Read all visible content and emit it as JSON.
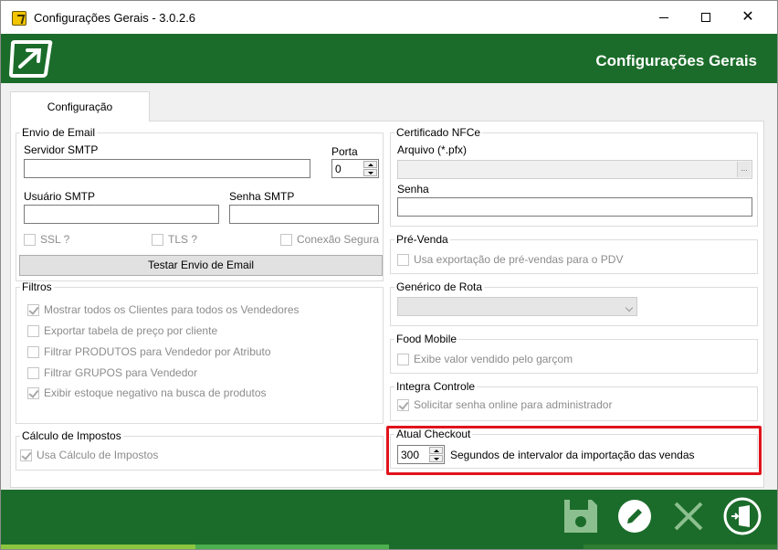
{
  "window": {
    "title": "Configurações Gerais - 3.0.2.6"
  },
  "header": {
    "title": "Configurações Gerais"
  },
  "tabs": [
    {
      "label": "Configuração"
    }
  ],
  "email": {
    "group_label": "Envio de Email",
    "smtp_server_label": "Servidor SMTP",
    "smtp_server_value": "",
    "port_label": "Porta",
    "port_value": "0",
    "user_label": "Usuário SMTP",
    "user_value": "",
    "password_label": "Senha SMTP",
    "password_value": "",
    "ssl_label": "SSL ?",
    "tls_label": "TLS ?",
    "secure_label": "Conexão Segura",
    "test_button": "Testar Envio de Email"
  },
  "filters": {
    "group_label": "Filtros",
    "items": [
      {
        "label": "Mostrar todos os Clientes para todos os Vendedores",
        "checked": true
      },
      {
        "label": "Exportar tabela de preço por cliente",
        "checked": false
      },
      {
        "label": "Filtrar PRODUTOS para Vendedor por Atributo",
        "checked": false
      },
      {
        "label": "Filtrar GRUPOS para Vendedor",
        "checked": false
      },
      {
        "label": "Exibir estoque negativo na busca de produtos",
        "checked": true
      }
    ]
  },
  "taxes": {
    "group_label": "Cálculo de Impostos",
    "use_label": "Usa Cálculo de Impostos",
    "checked": true
  },
  "nfce": {
    "group_label": "Certificado NFCe",
    "file_label": "Arquivo (*.pfx)",
    "file_value": "",
    "browse_label": "...",
    "password_label": "Senha",
    "password_value": ""
  },
  "presale": {
    "group_label": "Pré-Venda",
    "export_label": "Usa exportação de pré-vendas para o PDV",
    "checked": false
  },
  "route": {
    "group_label": "Genérico de Rota",
    "selected": ""
  },
  "food": {
    "group_label": "Food Mobile",
    "show_label": "Exibe valor vendido pelo garçom",
    "checked": false
  },
  "integra": {
    "group_label": "Integra Controle",
    "request_label": "Solicitar senha online para administrador",
    "checked": true
  },
  "checkout": {
    "group_label": "Atual Checkout",
    "interval_value": "300",
    "interval_label": "Segundos de intervalor da importação das vendas"
  },
  "footer": {
    "buttons": [
      "save-icon",
      "edit-icon",
      "cancel-icon",
      "exit-icon"
    ],
    "stripe_colors": [
      "#8cc63f",
      "#4caf50",
      "#1b6c2a",
      "#2e7d32"
    ]
  },
  "colors": {
    "brand_green": "#1b6c2a",
    "highlight": "#e0141c"
  }
}
